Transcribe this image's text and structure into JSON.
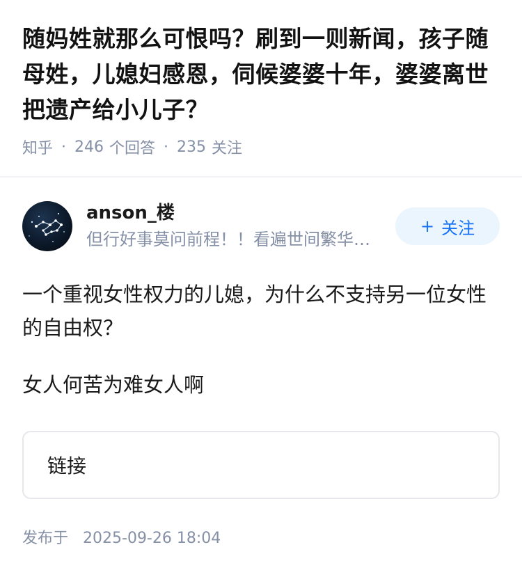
{
  "question": {
    "title": "随妈姓就那么可恨吗？刷到一则新闻，孩子随母姓，儿媳妇感恩，伺候婆婆十年，婆婆离世把遗产给小儿子？",
    "source": "知乎",
    "answers_count": "246",
    "answers_label": "个回答",
    "followers_count": "235",
    "followers_label": "关注",
    "separator": "·"
  },
  "author": {
    "avatar_icon": "constellation-avatar",
    "name": "anson_楼",
    "bio": "但行好事莫问前程！！看遍世间繁华，不如守着一方天地",
    "follow_plus": "+",
    "follow_label": "关注"
  },
  "answer": {
    "paragraphs": [
      "一个重视女性权力的儿媳，为什么不支持另一位女性的自由权？",
      "女人何苦为难女人啊"
    ]
  },
  "link_card": {
    "label": "链接"
  },
  "publish": {
    "label": "发布于",
    "datetime": "2025-09-26 18:04"
  },
  "colors": {
    "meta_gray": "#8590a6",
    "follow_bg": "#ebf5fd",
    "follow_text": "#1772f6",
    "divider": "#f0f2f5"
  }
}
